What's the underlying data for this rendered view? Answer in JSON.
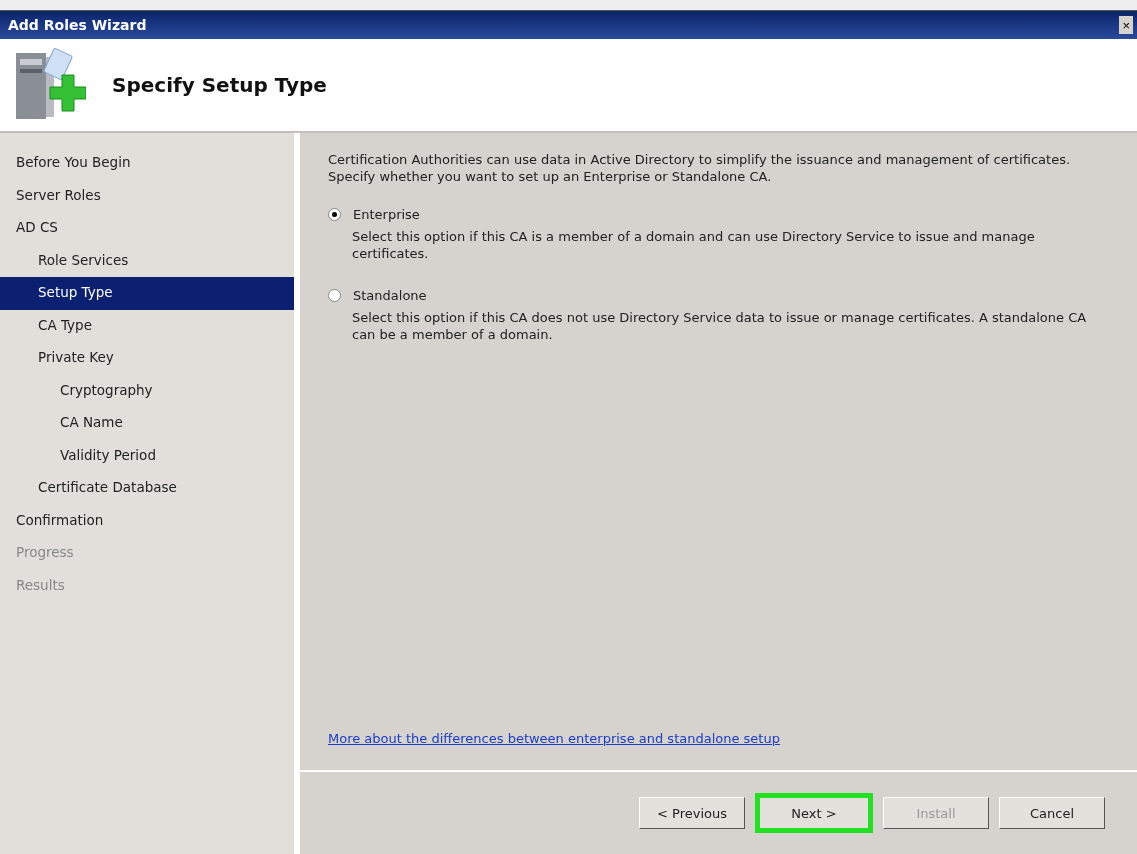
{
  "window": {
    "title": "Add Roles Wizard",
    "close": "×"
  },
  "header": {
    "title": "Specify Setup Type"
  },
  "sidebar": {
    "items": [
      {
        "label": "Before You Begin",
        "selected": false,
        "disabled": false
      },
      {
        "label": "Server Roles",
        "selected": false,
        "disabled": false
      },
      {
        "label": "AD CS",
        "selected": false,
        "disabled": false,
        "children": [
          {
            "label": "Role Services",
            "selected": false,
            "disabled": false
          },
          {
            "label": "Setup Type",
            "selected": true,
            "disabled": false
          },
          {
            "label": "CA Type",
            "selected": false,
            "disabled": false
          },
          {
            "label": "Private Key",
            "selected": false,
            "disabled": false,
            "children": [
              {
                "label": "Cryptography",
                "selected": false,
                "disabled": false
              },
              {
                "label": "CA Name",
                "selected": false,
                "disabled": false
              },
              {
                "label": "Validity Period",
                "selected": false,
                "disabled": false
              }
            ]
          },
          {
            "label": "Certificate Database",
            "selected": false,
            "disabled": false
          }
        ]
      },
      {
        "label": "Confirmation",
        "selected": false,
        "disabled": false
      },
      {
        "label": "Progress",
        "selected": false,
        "disabled": true
      },
      {
        "label": "Results",
        "selected": false,
        "disabled": true
      }
    ]
  },
  "content": {
    "intro": "Certification Authorities can use data in Active Directory to simplify the issuance and management of certificates. Specify whether you want to set up an Enterprise or Standalone CA.",
    "options": [
      {
        "label": "Enterprise",
        "selected": true,
        "description": "Select this option if this CA is a member of a domain and can use Directory Service to issue and manage certificates."
      },
      {
        "label": "Standalone",
        "selected": false,
        "description": "Select this option if this CA does not use Directory Service data to issue or manage certificates. A standalone CA can be a member of a domain."
      }
    ],
    "link": "More about the differences between enterprise and standalone setup"
  },
  "buttons": [
    {
      "label": "< Previous",
      "disabled": false,
      "highlighted": false
    },
    {
      "label": "Next >",
      "disabled": false,
      "highlighted": true
    },
    {
      "label": "Install",
      "disabled": true,
      "highlighted": false
    },
    {
      "label": "Cancel",
      "disabled": false,
      "highlighted": false
    }
  ]
}
